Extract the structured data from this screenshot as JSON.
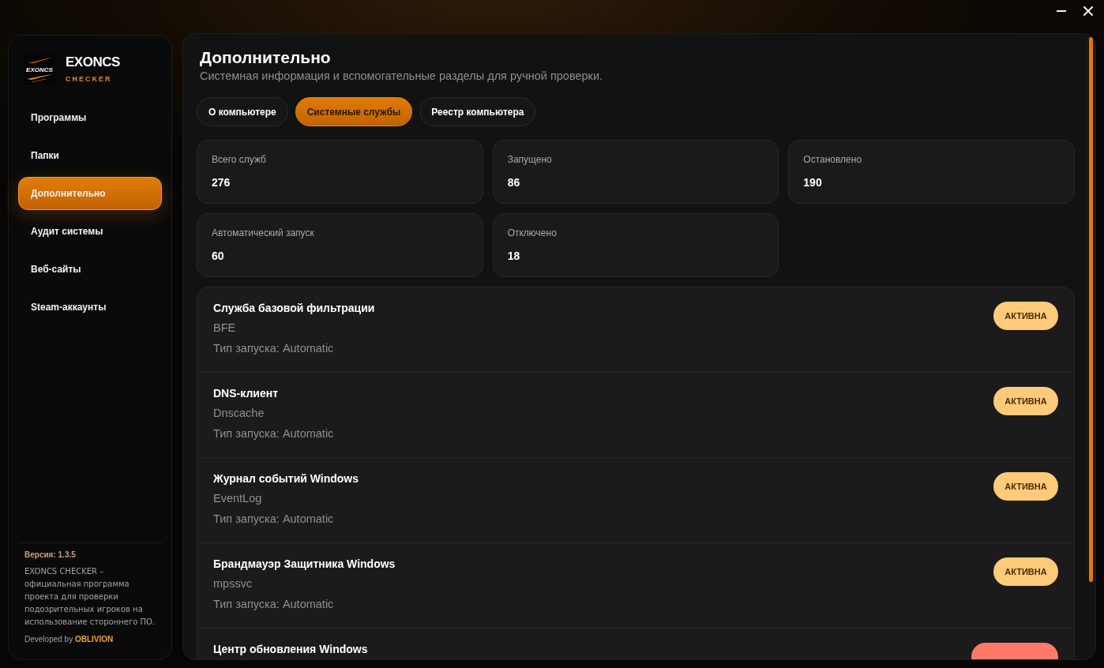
{
  "window_controls": [
    {
      "kind": "minimize"
    },
    {
      "kind": "close"
    }
  ],
  "sidebar": {
    "logo_text": "EXONCS",
    "brand": "EXONCS",
    "brand_sub": "CHECKER",
    "items": [
      {
        "label": "Программы",
        "selected": false
      },
      {
        "label": "Папки",
        "selected": false
      },
      {
        "label": "Дополнительно",
        "selected": true
      },
      {
        "label": "Аудит системы",
        "selected": false
      },
      {
        "label": "Веб-сайты",
        "selected": false
      },
      {
        "label": "Steam-аккаунты",
        "selected": false
      }
    ],
    "version": "Версия: 1.3.5",
    "description": "EXONCS CHECKER – официальная программа проекта для проверки подозрительных игроков на использование стороннего ПО.",
    "credit": "Developed by **OBLIVION**"
  },
  "page": {
    "title": "Дополнительно",
    "subtitle": "Системная информация и вспомогательные разделы для ручной проверки.",
    "tabs": [
      {
        "label": "О компьютере",
        "selected": false
      },
      {
        "label": "Системные службы",
        "selected": true
      },
      {
        "label": "Реестр компьютера",
        "selected": false
      }
    ],
    "stats": [
      {
        "label": "Всего служб",
        "value": "276"
      },
      {
        "label": "Запущено",
        "value": "86"
      },
      {
        "label": "Остановлено",
        "value": "190"
      },
      {
        "label": "Автоматический запуск",
        "value": "60"
      },
      {
        "label": "Отключено",
        "value": "18"
      }
    ],
    "services": [
      {
        "name": "Служба базовой фильтрации",
        "id": "BFE",
        "startup": "Тип запуска: Automatic",
        "badge": {
          "label": "АКТИВНА",
          "color": "#ffca7a"
        }
      },
      {
        "name": "DNS-клиент",
        "id": "Dnscache",
        "startup": "Тип запуска: Automatic",
        "badge": {
          "label": "АКТИВНА",
          "color": "#ffca7a"
        }
      },
      {
        "name": "Журнал событий Windows",
        "id": "EventLog",
        "startup": "Тип запуска: Automatic",
        "badge": {
          "label": "АКТИВНА",
          "color": "#ffca7a"
        }
      },
      {
        "name": "Брандмауэр Защитника Windows",
        "id": "mpssvc",
        "startup": "Тип запуска: Automatic",
        "badge": {
          "label": "АКТИВНА",
          "color": "#ffca7a"
        }
      },
      {
        "name": "Центр обновления Windows",
        "badge": {
          "color": "#ff7a66"
        }
      }
    ]
  }
}
